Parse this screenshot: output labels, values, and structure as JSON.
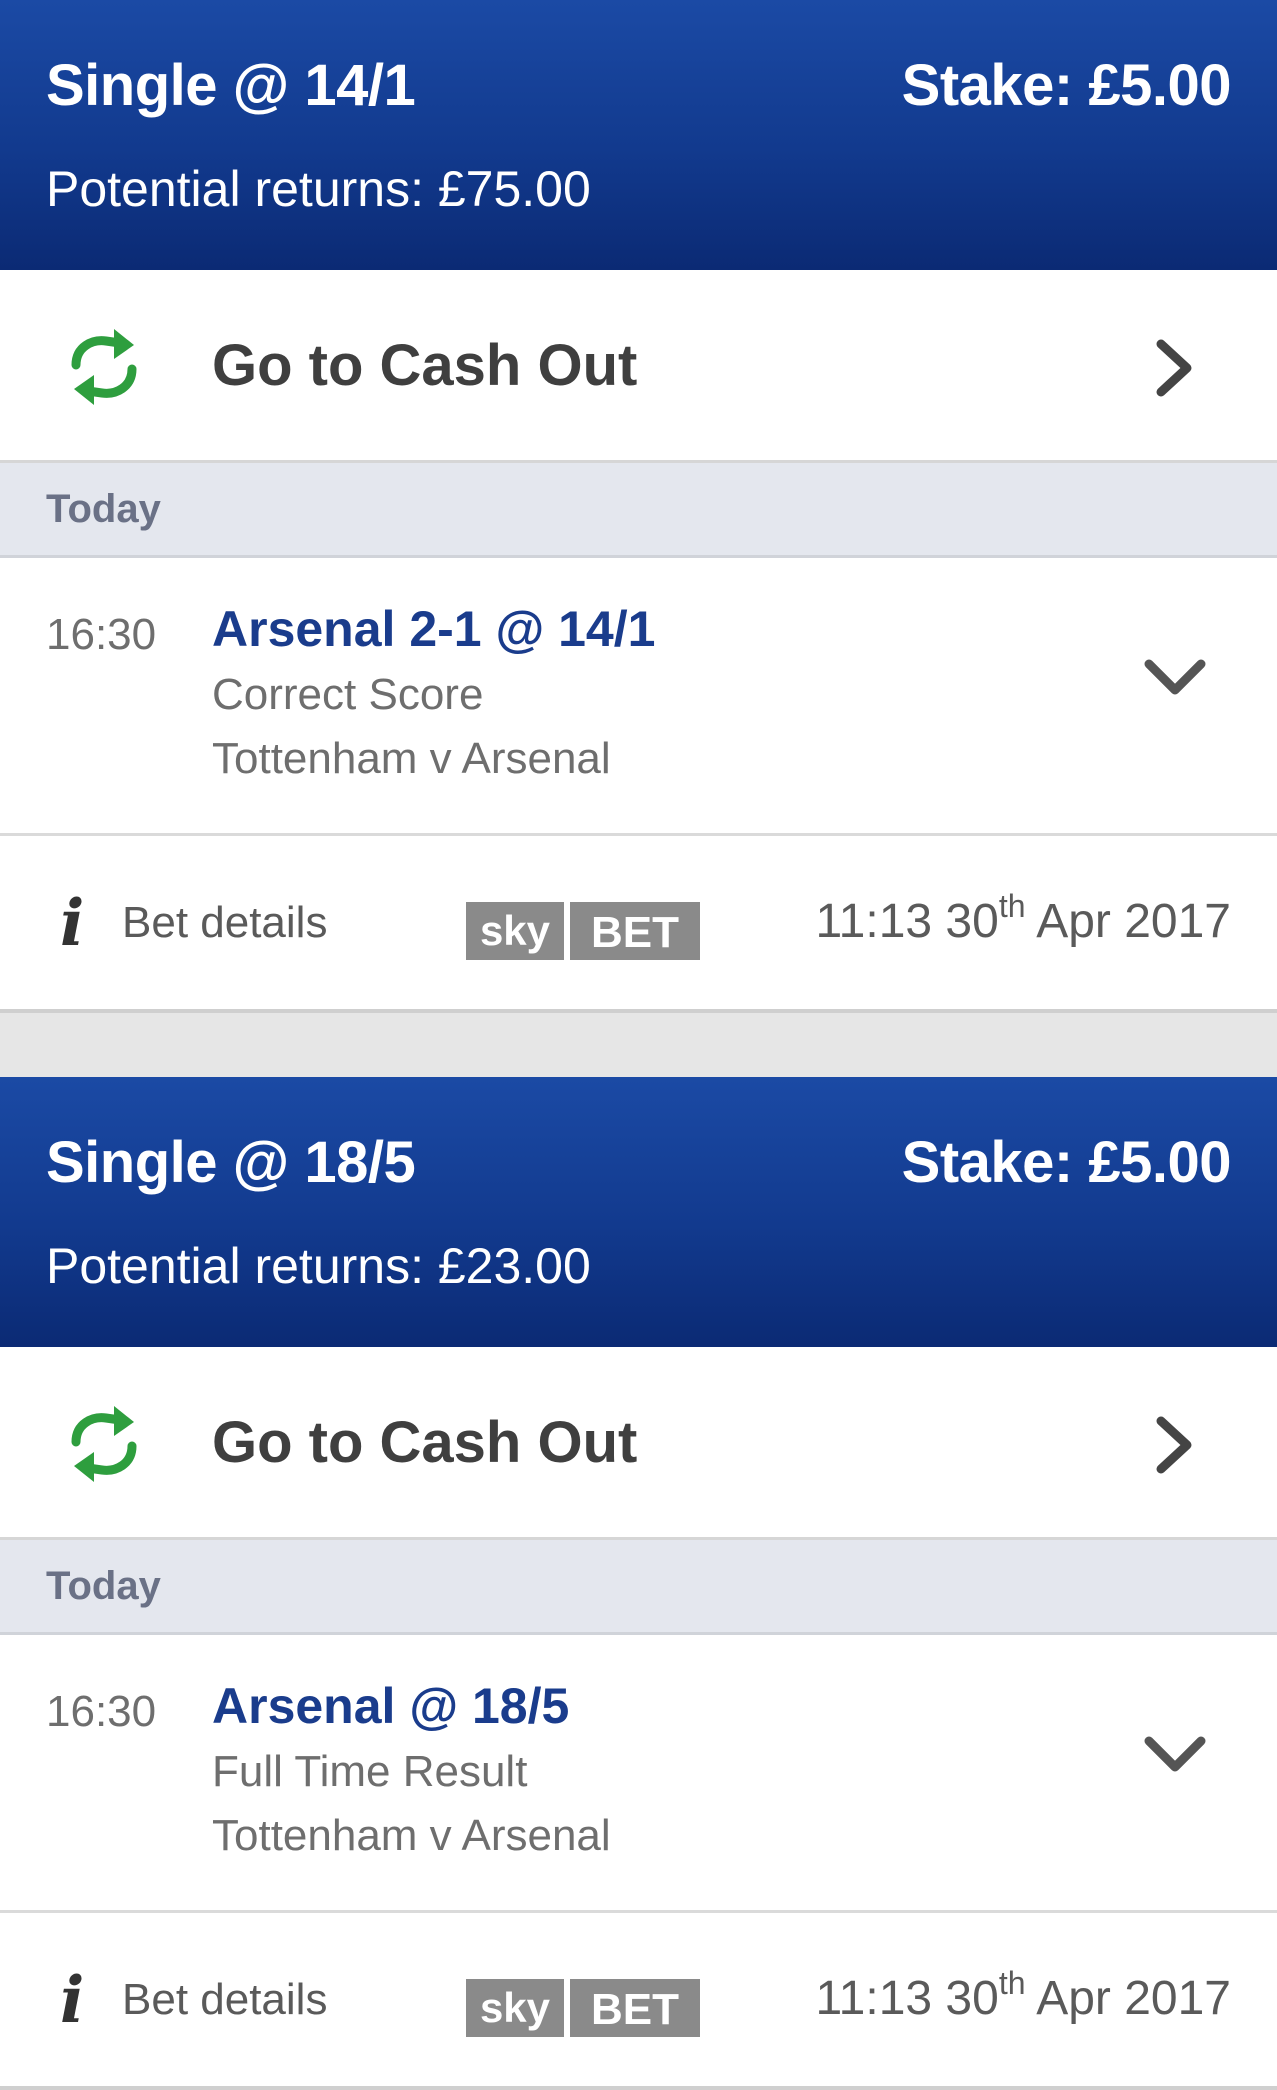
{
  "bets": [
    {
      "type": "Single @ 14/1",
      "stake": "Stake: £5.00",
      "returns": "Potential returns: £75.00",
      "cashout_label": "Go to Cash Out",
      "day": "Today",
      "selection": {
        "time": "16:30",
        "name": "Arsenal 2-1 @ 14/1",
        "market": "Correct Score",
        "event": "Tottenham v Arsenal"
      },
      "details_label": "Bet details",
      "brand": {
        "sky": "sky",
        "bet": "BET"
      },
      "placed": {
        "time_day": "11:13 30",
        "suffix": "th",
        "month_year": " Apr 2017"
      }
    },
    {
      "type": "Single @ 18/5",
      "stake": "Stake: £5.00",
      "returns": "Potential returns: £23.00",
      "cashout_label": "Go to Cash Out",
      "day": "Today",
      "selection": {
        "time": "16:30",
        "name": "Arsenal @ 18/5",
        "market": "Full Time Result",
        "event": "Tottenham v Arsenal"
      },
      "details_label": "Bet details",
      "brand": {
        "sky": "sky",
        "bet": "BET"
      },
      "placed": {
        "time_day": "11:13 30",
        "suffix": "th",
        "month_year": " Apr 2017"
      }
    }
  ],
  "icons": {
    "cashout": "cashout-arrows-icon",
    "chevron_right": "chevron-right-icon",
    "chevron_down": "chevron-down-icon",
    "info": "info-icon"
  },
  "colors": {
    "header_blue": "#123a8e",
    "selection_blue": "#1a3c8c",
    "cashout_green": "#2e9e3e",
    "day_bar": "#e4e7ee"
  }
}
